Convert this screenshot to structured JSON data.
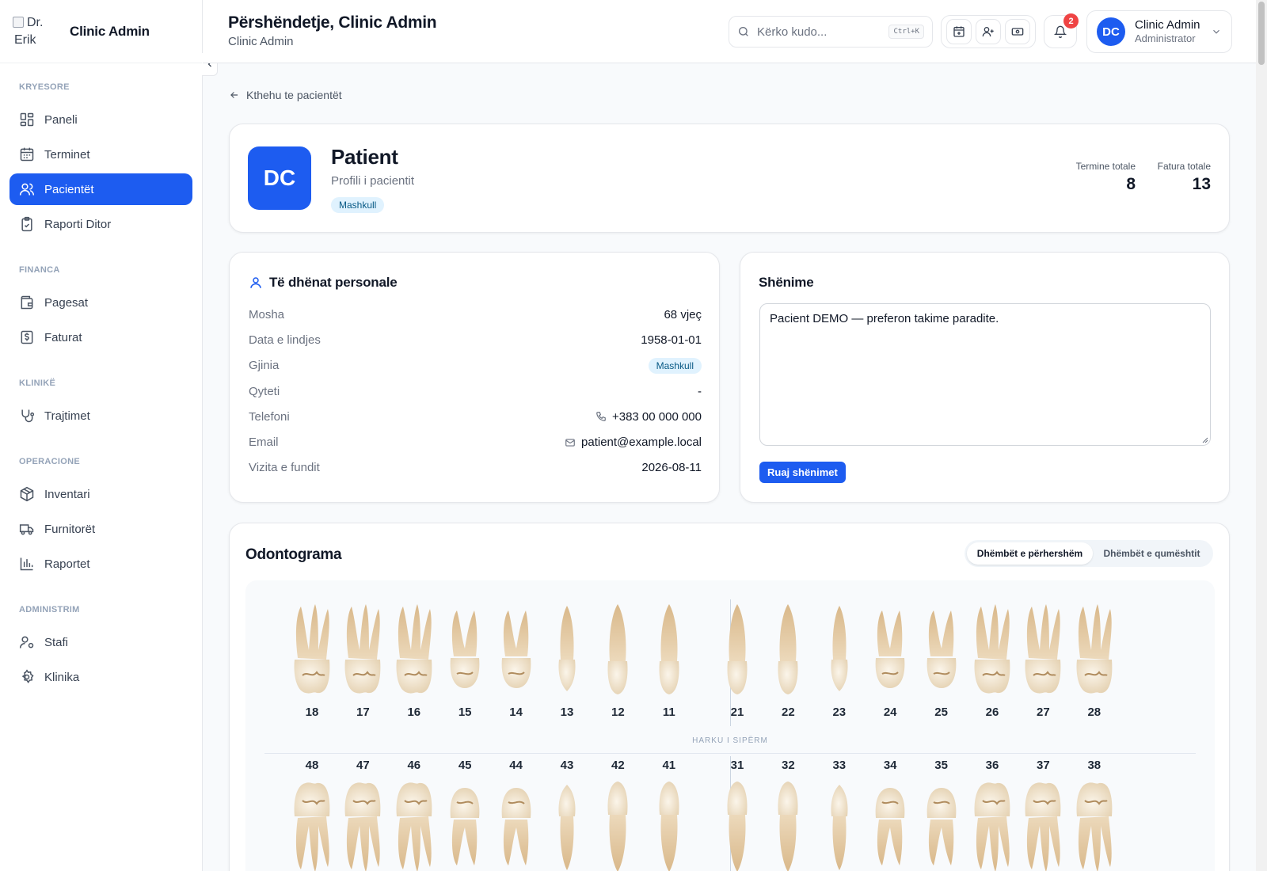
{
  "brand": {
    "logo_alt_line1": "Dr.",
    "logo_alt_line2": "Erik",
    "name": "Clinic Admin"
  },
  "sidebar": {
    "sections": [
      {
        "title": "KRYESORE",
        "items": [
          {
            "label": "Paneli",
            "icon": "grid-icon",
            "active": false
          },
          {
            "label": "Terminet",
            "icon": "calendar-icon",
            "active": false
          },
          {
            "label": "Pacientët",
            "icon": "users-icon",
            "active": true
          },
          {
            "label": "Raporti Ditor",
            "icon": "clipboard-check-icon",
            "active": false
          }
        ]
      },
      {
        "title": "FINANCA",
        "items": [
          {
            "label": "Pagesat",
            "icon": "wallet-icon",
            "active": false
          },
          {
            "label": "Faturat",
            "icon": "dollar-receipt-icon",
            "active": false
          }
        ]
      },
      {
        "title": "KLINIKË",
        "items": [
          {
            "label": "Trajtimet",
            "icon": "stethoscope-icon",
            "active": false
          }
        ]
      },
      {
        "title": "OPERACIONE",
        "items": [
          {
            "label": "Inventari",
            "icon": "box-icon",
            "active": false
          },
          {
            "label": "Furnitorët",
            "icon": "truck-icon",
            "active": false
          },
          {
            "label": "Raportet",
            "icon": "bar-chart-icon",
            "active": false
          }
        ]
      },
      {
        "title": "ADMINISTRIM",
        "items": [
          {
            "label": "Stafi",
            "icon": "user-cog-icon",
            "active": false
          },
          {
            "label": "Klinika",
            "icon": "settings-icon",
            "active": false
          }
        ]
      }
    ]
  },
  "header": {
    "greeting": "Përshëndetje, Clinic Admin",
    "subtitle": "Clinic Admin",
    "search_placeholder": "Kërko kudo...",
    "search_shortcut": "Ctrl+K",
    "notifications_count": "2",
    "user": {
      "initials": "DC",
      "name": "Clinic Admin",
      "role": "Administrator"
    }
  },
  "back_link": "Kthehu te pacientët",
  "patient": {
    "initials": "DC",
    "name": "Patient",
    "subtitle": "Profili i pacientit",
    "gender_tag": "Mashkull",
    "stats": [
      {
        "label": "Termine totale",
        "value": "8"
      },
      {
        "label": "Fatura totale",
        "value": "13"
      }
    ]
  },
  "personal": {
    "title": "Të dhënat personale",
    "rows": [
      {
        "label": "Mosha",
        "value": "68 vjeç"
      },
      {
        "label": "Data e lindjes",
        "value": "1958-01-01"
      },
      {
        "label": "Gjinia",
        "value": "Mashkull"
      },
      {
        "label": "Qyteti",
        "value": "-"
      },
      {
        "label": "Telefoni",
        "value": "+383 00 000 000"
      },
      {
        "label": "Email",
        "value": "patient@example.local"
      },
      {
        "label": "Vizita e fundit",
        "value": "2026-08-11"
      }
    ]
  },
  "notes": {
    "title": "Shënime",
    "text": "Pacient DEMO — preferon takime paradite.",
    "save_label": "Ruaj shënimet"
  },
  "odontogram": {
    "title": "Odontograma",
    "toggle": {
      "permanent": "Dhëmbët e përhershëm",
      "primary": "Dhëmbët e qumështit",
      "selected": "permanent"
    },
    "upper_label": "HARKU I SIPËRM",
    "upper_teeth": [
      "18",
      "17",
      "16",
      "15",
      "14",
      "13",
      "12",
      "11",
      "21",
      "22",
      "23",
      "24",
      "25",
      "26",
      "27",
      "28"
    ],
    "lower_teeth": [
      "48",
      "47",
      "46",
      "45",
      "44",
      "43",
      "42",
      "41",
      "31",
      "32",
      "33",
      "34",
      "35",
      "36",
      "37",
      "38"
    ]
  },
  "colors": {
    "accent": "#1d5cf0",
    "badge": "#ef4444",
    "pill_bg": "#e0f2fe",
    "pill_text": "#075985"
  }
}
